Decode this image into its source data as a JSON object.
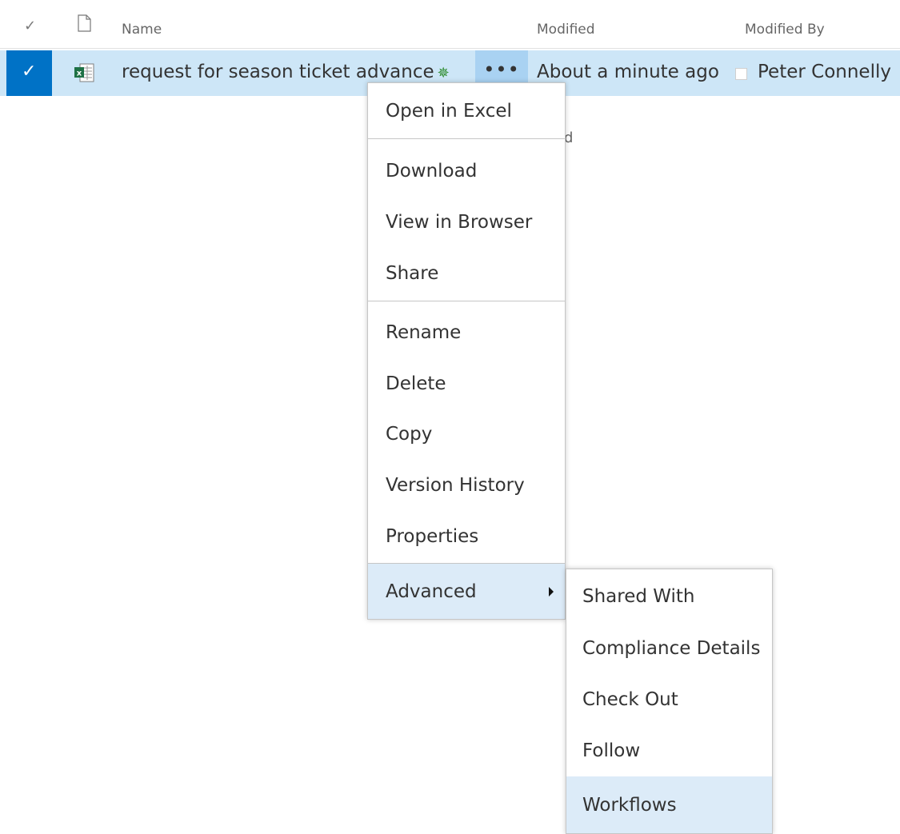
{
  "header": {
    "name_label": "Name",
    "modified_label": "Modified",
    "modified_by_label": "Modified By"
  },
  "row": {
    "name": "request for season ticket advance",
    "ellipsis": "•••",
    "modified": "About a minute ago",
    "modified_by": "Peter Connelly",
    "file_type_icon": "excel-file-icon",
    "new_badge_icon": "new-item-icon"
  },
  "behind_text": "ld",
  "context_menu": {
    "items": [
      {
        "label": "Open in Excel"
      },
      {
        "label": "Download"
      },
      {
        "label": "View in Browser"
      },
      {
        "label": "Share"
      },
      {
        "label": "Rename"
      },
      {
        "label": "Delete"
      },
      {
        "label": "Copy"
      },
      {
        "label": "Version History"
      },
      {
        "label": "Properties"
      },
      {
        "label": "Advanced"
      }
    ]
  },
  "advanced_submenu": {
    "items": [
      {
        "label": "Shared With"
      },
      {
        "label": "Compliance Details"
      },
      {
        "label": "Check Out"
      },
      {
        "label": "Follow"
      },
      {
        "label": "Workflows"
      }
    ]
  },
  "colors": {
    "accent": "#0072c6",
    "row_selected": "#cde6f7",
    "menu_hover": "#dcebf8",
    "excel_green": "#1e7145"
  }
}
